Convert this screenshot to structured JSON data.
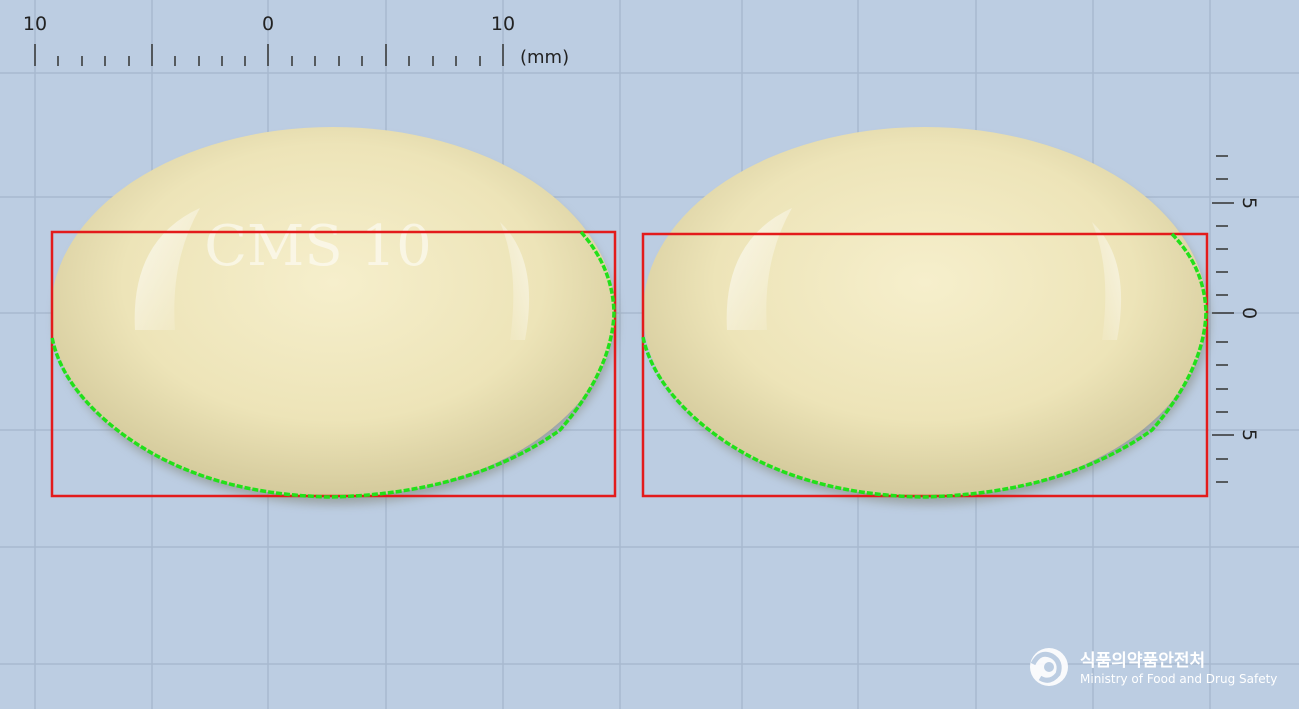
{
  "ruler": {
    "top_labels": [
      "10",
      "0",
      "10"
    ],
    "unit": "(mm)",
    "right_labels": [
      "5",
      "0",
      "5"
    ]
  },
  "pill_front": {
    "imprint": "CMS 10",
    "color": "#efe7bf"
  },
  "pill_back": {
    "imprint": "",
    "color": "#efe7bf"
  },
  "colors": {
    "background": "#bccde2",
    "grid": "#a8b9cf",
    "bounding_box": "#e31b1b",
    "contour": "#22e01a"
  },
  "logo": {
    "name_ko": "식품의약품안전처",
    "name_en": "Ministry of Food and Drug Safety",
    "icon": "ministry-emblem-icon"
  }
}
